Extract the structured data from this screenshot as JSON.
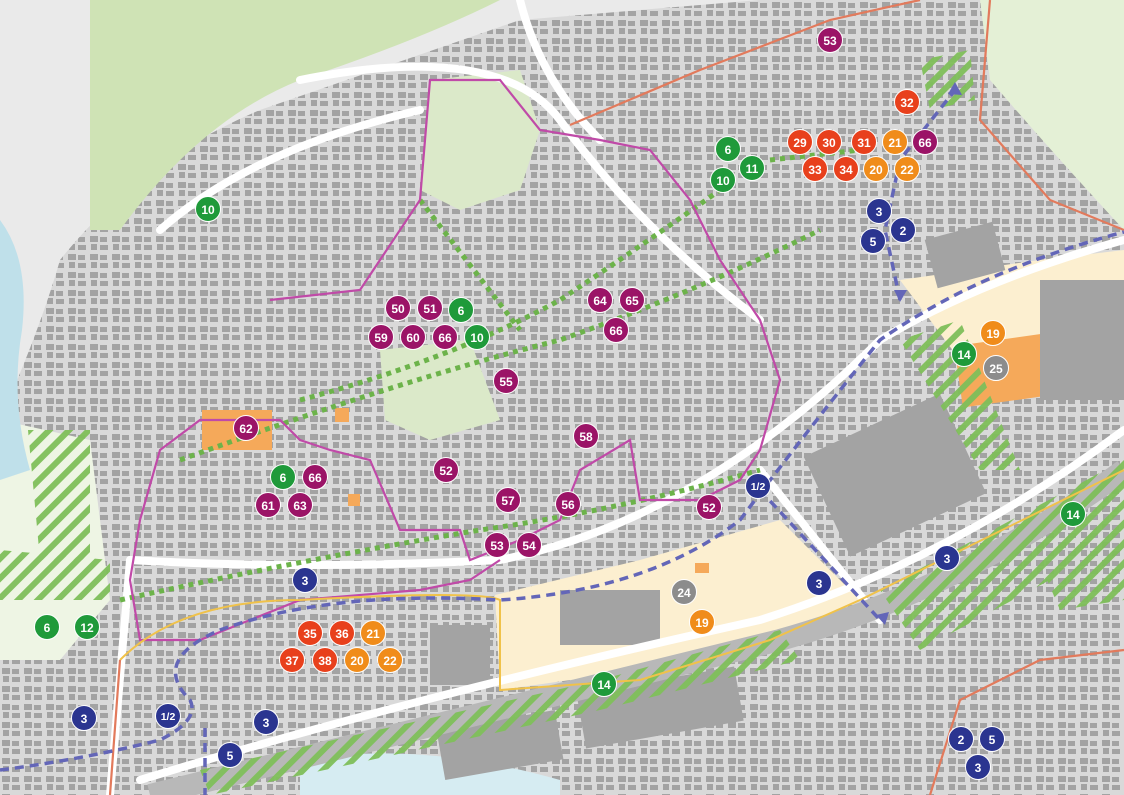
{
  "colors": {
    "purple": "#9b1467",
    "green": "#1f9a3a",
    "red": "#e8401c",
    "orange": "#f08c1a",
    "navy": "#2b3590",
    "gray": "#8c8c8c",
    "boundary_pink": "#c04aa8",
    "boundary_salmon": "#e27a5c",
    "green_area": "#cfe3b5",
    "orange_area": "#f5a95a",
    "beige_area": "#fcefd0",
    "water": "#bfe0ea",
    "building": "#9a9a9a",
    "street": "#ffffff",
    "path_green": "#6cb34a",
    "route_blue": "#6366b8"
  },
  "markers": [
    {
      "id": "m1",
      "label": "53",
      "color": "purple"
    },
    {
      "id": "m2",
      "label": "32",
      "color": "red"
    },
    {
      "id": "m3",
      "label": "29",
      "color": "red"
    },
    {
      "id": "m4",
      "label": "30",
      "color": "red"
    },
    {
      "id": "m5",
      "label": "31",
      "color": "red"
    },
    {
      "id": "m6",
      "label": "21",
      "color": "orange"
    },
    {
      "id": "m7",
      "label": "66",
      "color": "purple"
    },
    {
      "id": "m8",
      "label": "33",
      "color": "red"
    },
    {
      "id": "m9",
      "label": "34",
      "color": "red"
    },
    {
      "id": "m10",
      "label": "20",
      "color": "orange"
    },
    {
      "id": "m11",
      "label": "22",
      "color": "orange"
    },
    {
      "id": "m12",
      "label": "6",
      "color": "green"
    },
    {
      "id": "m13",
      "label": "10",
      "color": "green"
    },
    {
      "id": "m14",
      "label": "11",
      "color": "green"
    },
    {
      "id": "m15",
      "label": "3",
      "color": "navy"
    },
    {
      "id": "m16",
      "label": "5",
      "color": "navy"
    },
    {
      "id": "m17",
      "label": "2",
      "color": "navy"
    },
    {
      "id": "m18",
      "label": "10",
      "color": "green"
    },
    {
      "id": "m19",
      "label": "50",
      "color": "purple"
    },
    {
      "id": "m20",
      "label": "51",
      "color": "purple"
    },
    {
      "id": "m21",
      "label": "6",
      "color": "green"
    },
    {
      "id": "m22",
      "label": "59",
      "color": "purple"
    },
    {
      "id": "m23",
      "label": "60",
      "color": "purple"
    },
    {
      "id": "m24",
      "label": "66",
      "color": "purple"
    },
    {
      "id": "m25",
      "label": "10",
      "color": "green"
    },
    {
      "id": "m26",
      "label": "64",
      "color": "purple"
    },
    {
      "id": "m27",
      "label": "65",
      "color": "purple"
    },
    {
      "id": "m28",
      "label": "66",
      "color": "purple"
    },
    {
      "id": "m29",
      "label": "19",
      "color": "orange"
    },
    {
      "id": "m30",
      "label": "14",
      "color": "green"
    },
    {
      "id": "m31",
      "label": "25",
      "color": "gray"
    },
    {
      "id": "m32",
      "label": "55",
      "color": "purple"
    },
    {
      "id": "m33",
      "label": "62",
      "color": "purple"
    },
    {
      "id": "m34",
      "label": "58",
      "color": "purple"
    },
    {
      "id": "m35",
      "label": "52",
      "color": "purple"
    },
    {
      "id": "m36",
      "label": "6",
      "color": "green"
    },
    {
      "id": "m37",
      "label": "66",
      "color": "purple"
    },
    {
      "id": "m38",
      "label": "61",
      "color": "purple"
    },
    {
      "id": "m39",
      "label": "63",
      "color": "purple"
    },
    {
      "id": "m40",
      "label": "57",
      "color": "purple"
    },
    {
      "id": "m41",
      "label": "56",
      "color": "purple"
    },
    {
      "id": "m42",
      "label": "52",
      "color": "purple"
    },
    {
      "id": "m43",
      "label": "1/2",
      "color": "navy"
    },
    {
      "id": "m44",
      "label": "14",
      "color": "green"
    },
    {
      "id": "m45",
      "label": "53",
      "color": "purple"
    },
    {
      "id": "m46",
      "label": "54",
      "color": "purple"
    },
    {
      "id": "m47",
      "label": "3",
      "color": "navy"
    },
    {
      "id": "m48",
      "label": "3",
      "color": "navy"
    },
    {
      "id": "m49",
      "label": "24",
      "color": "gray"
    },
    {
      "id": "m50",
      "label": "19",
      "color": "orange"
    },
    {
      "id": "m51",
      "label": "3",
      "color": "navy"
    },
    {
      "id": "m52",
      "label": "6",
      "color": "green"
    },
    {
      "id": "m53",
      "label": "12",
      "color": "green"
    },
    {
      "id": "m54",
      "label": "35",
      "color": "red"
    },
    {
      "id": "m55",
      "label": "36",
      "color": "red"
    },
    {
      "id": "m56",
      "label": "21",
      "color": "orange"
    },
    {
      "id": "m57",
      "label": "37",
      "color": "red"
    },
    {
      "id": "m58",
      "label": "38",
      "color": "red"
    },
    {
      "id": "m59",
      "label": "20",
      "color": "orange"
    },
    {
      "id": "m60",
      "label": "22",
      "color": "orange"
    },
    {
      "id": "m61",
      "label": "14",
      "color": "green"
    },
    {
      "id": "m62",
      "label": "3",
      "color": "navy"
    },
    {
      "id": "m63",
      "label": "1/2",
      "color": "navy"
    },
    {
      "id": "m64",
      "label": "3",
      "color": "navy"
    },
    {
      "id": "m65",
      "label": "5",
      "color": "navy"
    },
    {
      "id": "m66",
      "label": "2",
      "color": "navy"
    },
    {
      "id": "m67",
      "label": "5",
      "color": "navy"
    },
    {
      "id": "m68",
      "label": "3",
      "color": "navy"
    }
  ]
}
